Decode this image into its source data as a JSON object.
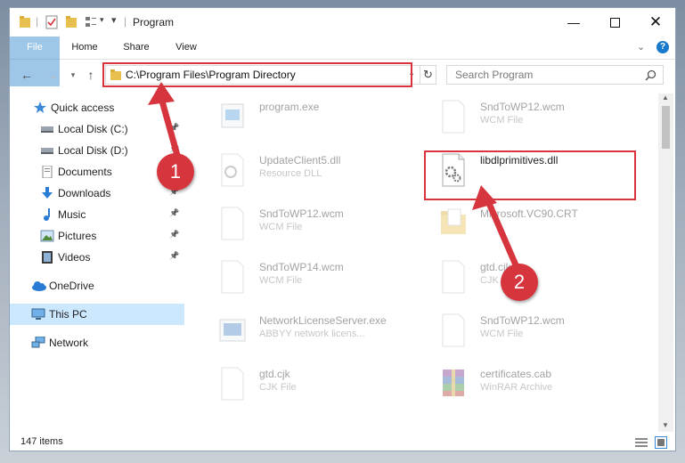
{
  "window": {
    "title": "Program",
    "controls": [
      "minimize-icon",
      "maximize-icon",
      "close-icon"
    ]
  },
  "ribbon": {
    "tabs": [
      "File",
      "Home",
      "Share",
      "View"
    ]
  },
  "address": {
    "path": "C:\\Program Files\\Program Directory",
    "search_placeholder": "Search Program"
  },
  "sidebar": {
    "items": [
      {
        "label": "Quick access",
        "icon": "star-icon",
        "pinned": false
      },
      {
        "label": "Local Disk (C:)",
        "icon": "disk-icon",
        "pinned": true
      },
      {
        "label": "Local Disk (D:)",
        "icon": "disk-icon",
        "pinned": true
      },
      {
        "label": "Documents",
        "icon": "documents-icon",
        "pinned": true
      },
      {
        "label": "Downloads",
        "icon": "download-icon",
        "pinned": true
      },
      {
        "label": "Music",
        "icon": "music-icon",
        "pinned": true
      },
      {
        "label": "Pictures",
        "icon": "pictures-icon",
        "pinned": true
      },
      {
        "label": "Videos",
        "icon": "videos-icon",
        "pinned": true
      },
      {
        "label": "OneDrive",
        "icon": "cloud-icon",
        "pinned": false
      },
      {
        "label": "This PC",
        "icon": "pc-icon",
        "pinned": false
      },
      {
        "label": "Network",
        "icon": "network-icon",
        "pinned": false
      }
    ]
  },
  "files": [
    {
      "name": "program.exe",
      "desc": ""
    },
    {
      "name": "SndToWP12.wcm",
      "desc": "WCM File"
    },
    {
      "name": "UpdateClient5.dll",
      "desc": "Resource DLL"
    },
    {
      "name": "libdlprimitives.dll",
      "desc": ""
    },
    {
      "name": "SndToWP12.wcm",
      "desc": "WCM File"
    },
    {
      "name": "Microsoft.VC90.CRT",
      "desc": ""
    },
    {
      "name": "SndToWP14.wcm",
      "desc": "WCM File"
    },
    {
      "name": "gtd.cjk",
      "desc": "CJK File"
    },
    {
      "name": "NetworkLicenseServer.exe",
      "desc": "ABBYY network licens..."
    },
    {
      "name": "SndToWP12.wcm",
      "desc": "WCM File"
    },
    {
      "name": "gtd.cjk",
      "desc": "CJK File"
    },
    {
      "name": "certificates.cab",
      "desc": "WinRAR Archive"
    }
  ],
  "status": {
    "item_count": "147 items"
  },
  "annotations": {
    "step1": "1",
    "step2": "2"
  },
  "colors": {
    "accent": "#1979ca",
    "highlight": "#d9333d",
    "selected": "#cce8ff"
  }
}
